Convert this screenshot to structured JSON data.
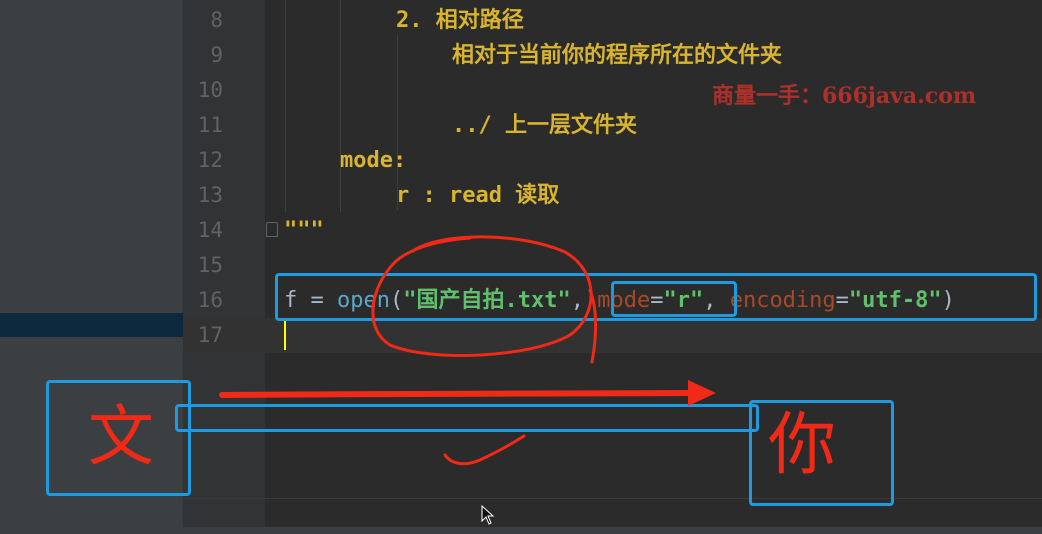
{
  "editor": {
    "line_numbers": [
      "8",
      "9",
      "10",
      "11",
      "12",
      "13",
      "14",
      "15",
      "16",
      "17"
    ],
    "doc_lines": {
      "l8": "2. 相对路径",
      "l9": "相对于当前你的程序所在的文件夹",
      "l11": "../ 上一层文件夹",
      "l12": "mode:",
      "l13": "r : read 读取",
      "l14": "\"\"\""
    },
    "code_line16": {
      "var": "f",
      "eq": " = ",
      "func": "open",
      "paren_open": "(",
      "filename": "\"国产自拍.txt\"",
      "comma1": ", ",
      "mode_kw": "mode",
      "mode_eq": "=",
      "mode_val": "\"r\"",
      "comma2": ", ",
      "enc_kw": "encoding",
      "enc_eq": "=",
      "enc_val": "\"utf-8\"",
      "paren_close": ")"
    }
  },
  "watermark": "商量一手：666java.com",
  "annotations": {
    "left_char": "文",
    "right_char": "你"
  },
  "colors": {
    "background": "#2b2b2b",
    "docstring": "#d8b431",
    "string": "#6a8759",
    "keyword_arg": "#aa4926",
    "function": "#5aa7c7",
    "box_blue": "#1e9be0",
    "ink_red": "#f02a16"
  }
}
